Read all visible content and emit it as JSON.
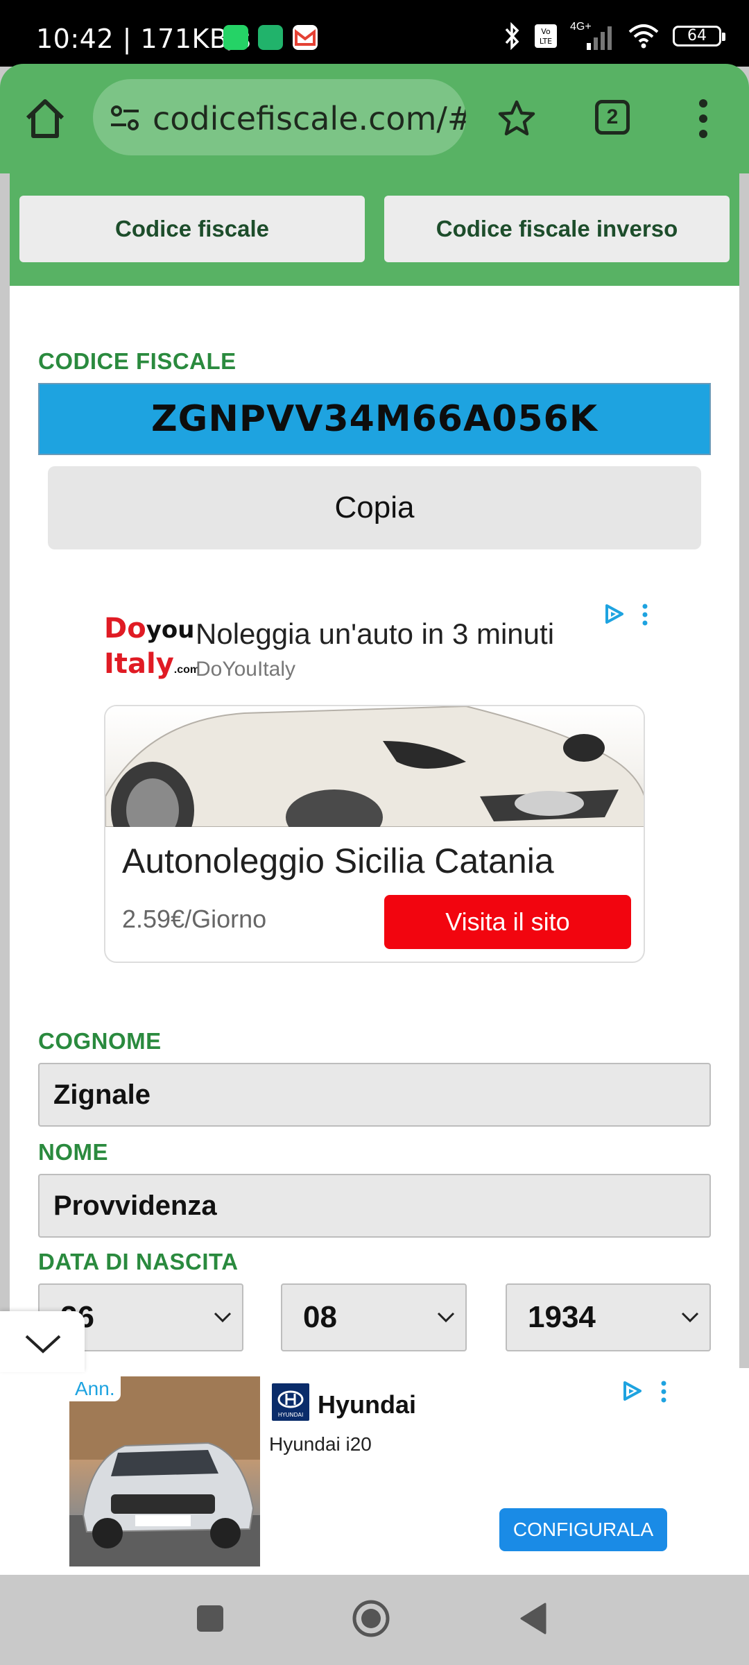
{
  "status_bar": {
    "time": "10:42 | 171KB/s",
    "network": "4G+",
    "battery": "64"
  },
  "browser": {
    "url": "codicefiscale.com/#c",
    "tab_count": "2"
  },
  "tabs": {
    "codice_fiscale": "Codice fiscale",
    "codice_fiscale_inverso": "Codice fiscale inverso"
  },
  "codice_fiscale": {
    "label": "CODICE FISCALE",
    "value": "ZGNPVV34M66A056K",
    "copy_label": "Copia"
  },
  "ad_top": {
    "logo_line1_a": "Do",
    "logo_line1_b": "you",
    "logo_line2": "Italy",
    "logo_suffix": ".com",
    "title": "Noleggia un'auto in 3 minuti",
    "advertiser": "DoYouItaly",
    "headline": "Autonoleggio Sicilia Catania",
    "price": "2.59€/Giorno",
    "cta": "Visita il sito"
  },
  "form": {
    "cognome_label": "COGNOME",
    "cognome_value": "Zignale",
    "nome_label": "NOME",
    "nome_value": "Provvidenza",
    "data_label": "DATA DI NASCITA",
    "day": "26",
    "month": "08",
    "year": "1934"
  },
  "ad_bottom": {
    "badge": "Ann.",
    "brand": "Hyundai",
    "logo_text": "HYUNDAI",
    "model": "Hyundai i20",
    "cta": "CONFIGURALA"
  },
  "colors": {
    "toolbar_green": "#58b264",
    "label_green": "#2a8a3e",
    "cf_blue": "#1ea3e0",
    "cta_red": "#f2050f",
    "cta_blue": "#1a8be6"
  }
}
